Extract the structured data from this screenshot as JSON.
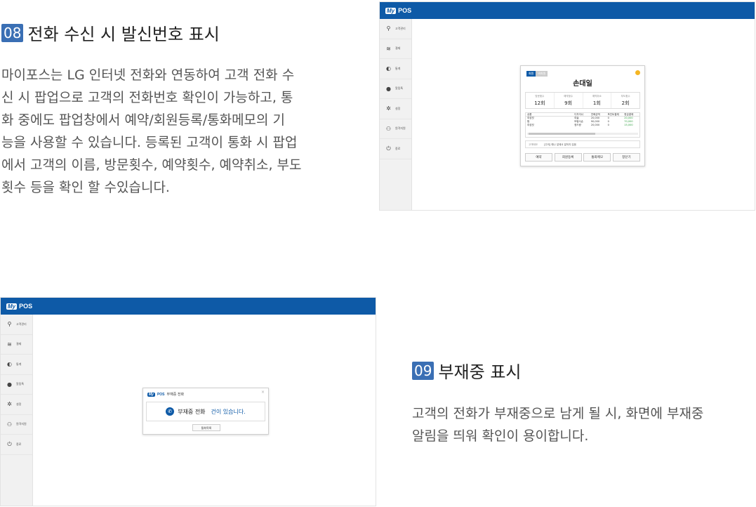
{
  "section1": {
    "number": "08",
    "title": "전화 수신 시 발신번호 표시",
    "desc_lines": [
      "마이포스는 LG 인터넷 전화와 연동하여 고객 전화 수",
      "신 시 팝업으로 고객의 전화번호 확인이 가능하고, 통",
      "화 중에도 팝업창에서 예약/회원등록/통화메모의 기",
      "능을 사용할 수 있습니다. 등록된 고객이 통화 시 팝업",
      "에서 고객의 이름, 방문횟수, 예약횟수, 예약취소, 부도",
      "횟수 등을 확인 할 수있습니다."
    ]
  },
  "section2": {
    "number": "09",
    "title": "부재중 표시",
    "desc_lines": [
      "고객의 전화가 부재중으로 남게 될 시, 화면에 부재중",
      "알림을 띄워 확인이 용이합니다."
    ]
  },
  "app": {
    "logo_my": "My",
    "logo_text": "POS",
    "sidebar": [
      {
        "icon": "user-icon",
        "glyph": "⚲",
        "label": "고객관리"
      },
      {
        "icon": "payment-icon",
        "glyph": "≋",
        "label": "결제"
      },
      {
        "icon": "stats-icon",
        "glyph": "◐",
        "label": "통계"
      },
      {
        "icon": "message-icon",
        "glyph": "●",
        "label": "알림톡"
      },
      {
        "icon": "settings-icon",
        "glyph": "✲",
        "label": "설정"
      },
      {
        "icon": "remote-icon",
        "glyph": "⚇",
        "label": "원격지원"
      },
      {
        "icon": "power-icon",
        "glyph": "⏻",
        "label": "종료"
      }
    ]
  },
  "popup1": {
    "tabs": [
      "회원",
      "비회원"
    ],
    "name": "손대일",
    "stats": [
      {
        "label": "방문횟수",
        "value": "12회"
      },
      {
        "label": "예약횟수",
        "value": "9회"
      },
      {
        "label": "예약취소",
        "value": "1회"
      },
      {
        "label": "부도횟수",
        "value": "2회"
      }
    ],
    "table_head": [
      "상품",
      "디자이너",
      "전화금액",
      "포인트결제",
      "현금결제"
    ],
    "table_rows": [
      [
        "여성컷",
        "여솔",
        "20,000",
        "0",
        "20,000"
      ],
      [
        "펌",
        "보람사손",
        "90,000",
        "0",
        "70,000"
      ],
      [
        "여성컷",
        "정드랑",
        "20,000",
        "0",
        "15,000"
      ]
    ],
    "memo_label": "고객메모",
    "memo_text": "[주의] 예나 앞에서 말하지 않음",
    "buttons": [
      "예약",
      "회원등록",
      "통화메모",
      "창닫기"
    ]
  },
  "popup2": {
    "header": "부재중 전화",
    "close": "×",
    "message_pre": "부재중 전화",
    "message_post": "건이 있습니다.",
    "button": "통화목록"
  }
}
